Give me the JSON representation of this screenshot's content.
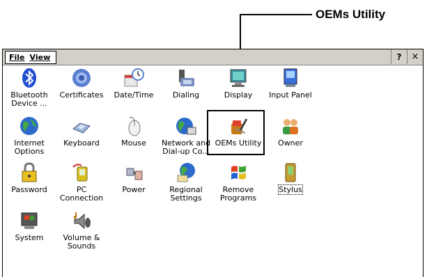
{
  "callout": {
    "label": "OEMs Utility"
  },
  "menu": {
    "file": "File",
    "view": "View",
    "help": "?",
    "close": "×"
  },
  "items": [
    {
      "l1": "Bluetooth",
      "l2": "Device ..."
    },
    {
      "l1": "Certificates",
      "l2": ""
    },
    {
      "l1": "Date/Time",
      "l2": ""
    },
    {
      "l1": "Dialing",
      "l2": ""
    },
    {
      "l1": "Display",
      "l2": ""
    },
    {
      "l1": "Input Panel",
      "l2": ""
    },
    {
      "l1": "Internet",
      "l2": "Options"
    },
    {
      "l1": "Keyboard",
      "l2": ""
    },
    {
      "l1": "Mouse",
      "l2": ""
    },
    {
      "l1": "Network and",
      "l2": "Dial-up Co..."
    },
    {
      "l1": "OEMs Utility",
      "l2": ""
    },
    {
      "l1": "Owner",
      "l2": ""
    },
    {
      "l1": "Password",
      "l2": ""
    },
    {
      "l1": "PC",
      "l2": "Connection"
    },
    {
      "l1": "Power",
      "l2": ""
    },
    {
      "l1": "Regional",
      "l2": "Settings"
    },
    {
      "l1": "Remove",
      "l2": "Programs"
    },
    {
      "l1": "Stylus",
      "l2": ""
    },
    {
      "l1": "System",
      "l2": ""
    },
    {
      "l1": "Volume &",
      "l2": "Sounds"
    }
  ]
}
